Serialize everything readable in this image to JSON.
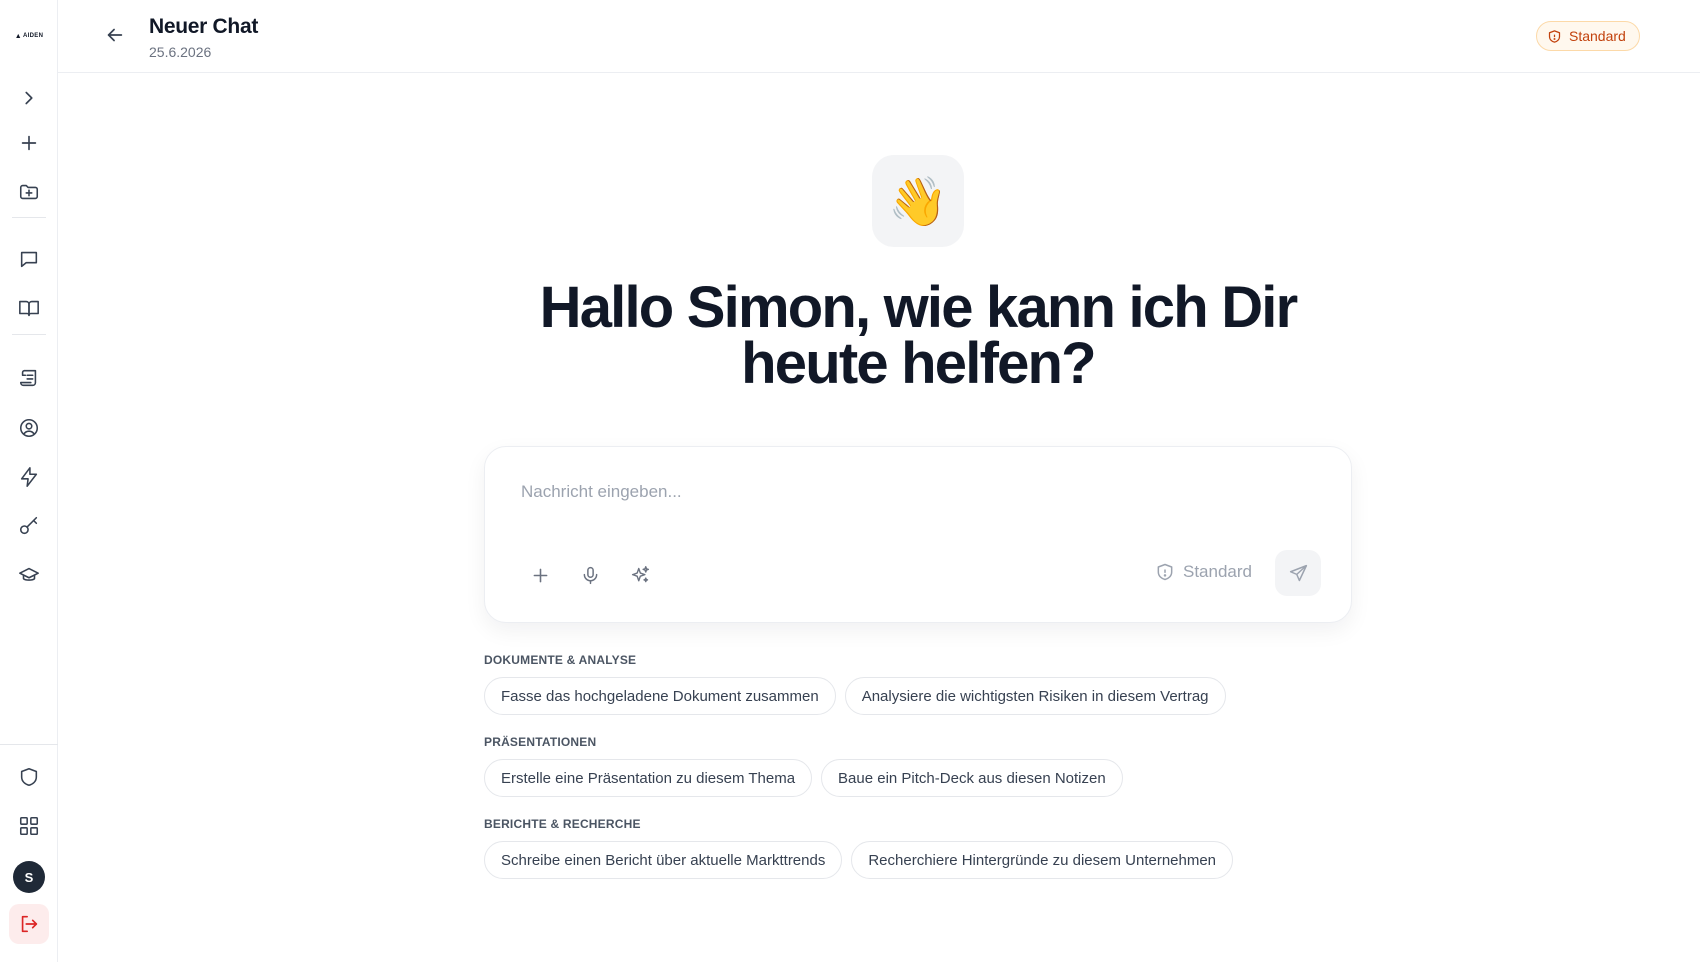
{
  "sidebar": {
    "logo_text": "AIDEN",
    "avatar_initial": "S",
    "items": [
      {
        "name": "expand-sidebar",
        "icon": "chevron-right-icon"
      },
      {
        "name": "new-chat",
        "icon": "plus-icon"
      },
      {
        "name": "new-folder",
        "icon": "folder-plus-icon"
      },
      {
        "name": "chats",
        "icon": "chat-bubble-icon"
      },
      {
        "name": "library",
        "icon": "book-icon"
      },
      {
        "name": "prompts",
        "icon": "scroll-icon"
      },
      {
        "name": "assistants",
        "icon": "user-circle-icon"
      },
      {
        "name": "automations",
        "icon": "lightning-icon"
      },
      {
        "name": "keys",
        "icon": "key-icon"
      },
      {
        "name": "academy",
        "icon": "graduation-cap-icon"
      },
      {
        "name": "security",
        "icon": "shield-icon"
      },
      {
        "name": "apps",
        "icon": "grid-icon"
      },
      {
        "name": "logout",
        "icon": "logout-icon"
      }
    ]
  },
  "header": {
    "title": "Neuer Chat",
    "date": "25.6.2026",
    "badge_label": "Standard"
  },
  "main": {
    "emoji": "👋",
    "greeting": "Hallo Simon, wie kann ich Dir heute helfen?",
    "composer": {
      "placeholder": "Nachricht eingeben...",
      "value": "",
      "mode_label": "Standard"
    },
    "sections": [
      {
        "title": "DOKUMENTE & ANALYSE",
        "chips": [
          "Fasse das hochgeladene Dokument zusammen",
          "Analysiere die wichtigsten Risiken in diesem Vertrag"
        ]
      },
      {
        "title": "PRÄSENTATIONEN",
        "chips": [
          "Erstelle eine Präsentation zu diesem Thema",
          "Baue ein Pitch-Deck aus diesen Notizen"
        ]
      },
      {
        "title": "BERICHTE & RECHERCHE",
        "chips": [
          "Schreibe einen Bericht über aktuelle Markttrends",
          "Recherchiere Hintergründe zu diesem Unternehmen"
        ]
      }
    ]
  },
  "colors": {
    "badge_text": "#c2410c",
    "badge_bg": "#fff8ee",
    "logout": "#dc2626",
    "text_primary": "#111827"
  }
}
